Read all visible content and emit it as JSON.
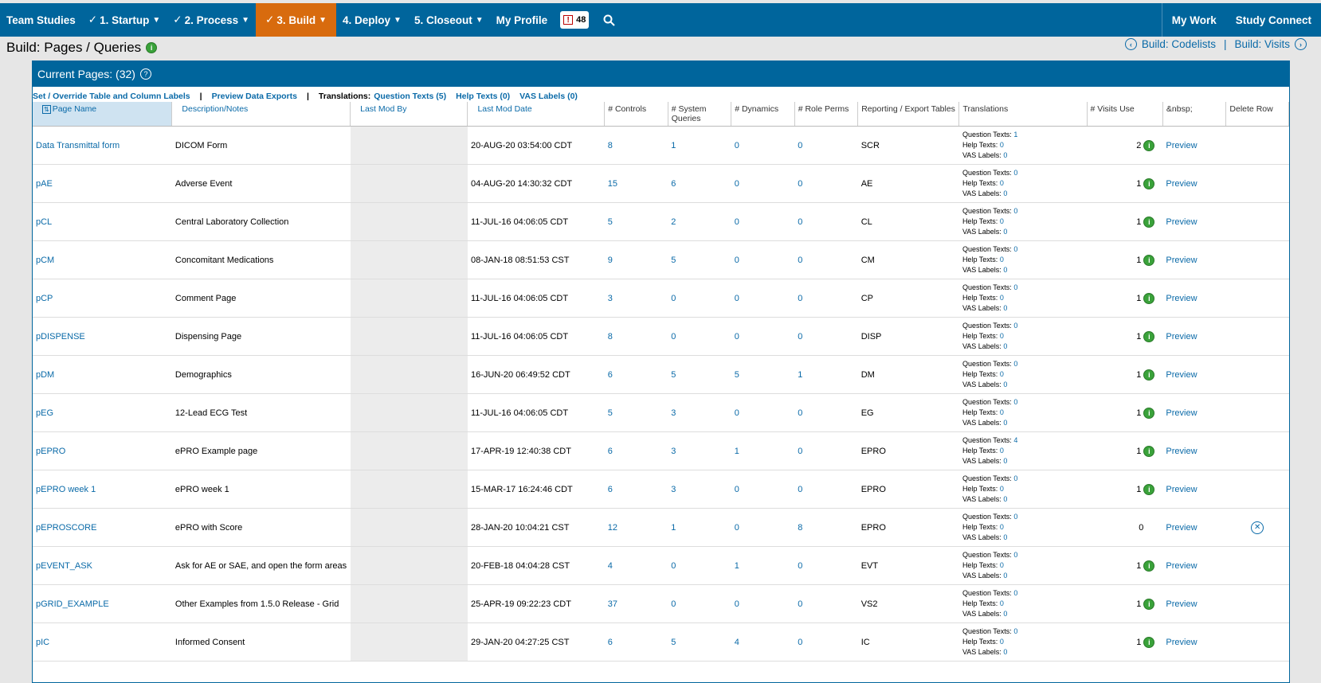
{
  "nav": {
    "brand": "Team Studies",
    "items": [
      {
        "label": "1. Startup",
        "check": true,
        "caret": true,
        "active": false
      },
      {
        "label": "2. Process",
        "check": true,
        "caret": true,
        "active": false
      },
      {
        "label": "3. Build",
        "check": true,
        "caret": true,
        "active": true
      },
      {
        "label": "4. Deploy",
        "check": false,
        "caret": true,
        "active": false
      },
      {
        "label": "5. Closeout",
        "check": false,
        "caret": true,
        "active": false
      },
      {
        "label": "My Profile",
        "check": false,
        "caret": false,
        "active": false
      }
    ],
    "alert_count": "48",
    "right": [
      "My Work",
      "Study Connect"
    ]
  },
  "page": {
    "title": "Build: Pages / Queries",
    "prev_link": "Build: Codelists",
    "separator": "|",
    "next_link": "Build: Visits"
  },
  "panel": {
    "title": "Current Pages: (32)",
    "links": {
      "override": "Set / Override Table and Column Labels",
      "preview": "Preview Data Exports",
      "translations_label": "Translations:",
      "question_texts": "Question Texts (5)",
      "help_texts": "Help Texts (0)",
      "vas_labels": "VAS Labels (0)"
    }
  },
  "columns": [
    "Page Name",
    "Description/Notes",
    "Last Mod By",
    "Last Mod Date",
    "# Controls",
    "# System Queries",
    "# Dynamics",
    "# Role Perms",
    "Reporting / Export Tables",
    "Translations",
    "# Visits Use",
    "&nbsp;",
    "Delete Row"
  ],
  "trans_labels": {
    "q": "Question Texts:",
    "h": "Help Texts:",
    "v": "VAS Labels:"
  },
  "preview_label": "Preview",
  "rows": [
    {
      "name": "Data Transmittal form",
      "desc": "DICOM Form",
      "date": "20-AUG-20 03:54:00 CDT",
      "controls": "8",
      "sysq": "1",
      "dyn": "0",
      "role": "0",
      "table": "SCR",
      "q": "1",
      "h": "0",
      "v": "0",
      "visits": "2",
      "info": true,
      "del": false
    },
    {
      "name": "pAE",
      "desc": "Adverse Event",
      "date": "04-AUG-20 14:30:32 CDT",
      "controls": "15",
      "sysq": "6",
      "dyn": "0",
      "role": "0",
      "table": "AE",
      "q": "0",
      "h": "0",
      "v": "0",
      "visits": "1",
      "info": true,
      "del": false
    },
    {
      "name": "pCL",
      "desc": "Central Laboratory Collection",
      "date": "11-JUL-16 04:06:05 CDT",
      "controls": "5",
      "sysq": "2",
      "dyn": "0",
      "role": "0",
      "table": "CL",
      "q": "0",
      "h": "0",
      "v": "0",
      "visits": "1",
      "info": true,
      "del": false
    },
    {
      "name": "pCM",
      "desc": "Concomitant Medications",
      "date": "08-JAN-18 08:51:53 CST",
      "controls": "9",
      "sysq": "5",
      "dyn": "0",
      "role": "0",
      "table": "CM",
      "q": "0",
      "h": "0",
      "v": "0",
      "visits": "1",
      "info": true,
      "del": false
    },
    {
      "name": "pCP",
      "desc": "Comment Page",
      "date": "11-JUL-16 04:06:05 CDT",
      "controls": "3",
      "sysq": "0",
      "dyn": "0",
      "role": "0",
      "table": "CP",
      "q": "0",
      "h": "0",
      "v": "0",
      "visits": "1",
      "info": true,
      "del": false
    },
    {
      "name": "pDISPENSE",
      "desc": "Dispensing Page",
      "date": "11-JUL-16 04:06:05 CDT",
      "controls": "8",
      "sysq": "0",
      "dyn": "0",
      "role": "0",
      "table": "DISP",
      "q": "0",
      "h": "0",
      "v": "0",
      "visits": "1",
      "info": true,
      "del": false
    },
    {
      "name": "pDM",
      "desc": "Demographics",
      "date": "16-JUN-20 06:49:52 CDT",
      "controls": "6",
      "sysq": "5",
      "dyn": "5",
      "role": "1",
      "table": "DM",
      "q": "0",
      "h": "0",
      "v": "0",
      "visits": "1",
      "info": true,
      "del": false
    },
    {
      "name": "pEG",
      "desc": "12-Lead ECG Test",
      "date": "11-JUL-16 04:06:05 CDT",
      "controls": "5",
      "sysq": "3",
      "dyn": "0",
      "role": "0",
      "table": "EG",
      "q": "0",
      "h": "0",
      "v": "0",
      "visits": "1",
      "info": true,
      "del": false
    },
    {
      "name": "pEPRO",
      "desc": "ePRO Example page",
      "date": "17-APR-19 12:40:38 CDT",
      "controls": "6",
      "sysq": "3",
      "dyn": "1",
      "role": "0",
      "table": "EPRO",
      "q": "4",
      "h": "0",
      "v": "0",
      "visits": "1",
      "info": true,
      "del": false
    },
    {
      "name": "pEPRO week 1",
      "desc": "ePRO week 1",
      "date": "15-MAR-17 16:24:46 CDT",
      "controls": "6",
      "sysq": "3",
      "dyn": "0",
      "role": "0",
      "table": "EPRO",
      "q": "0",
      "h": "0",
      "v": "0",
      "visits": "1",
      "info": true,
      "del": false
    },
    {
      "name": "pEPROSCORE",
      "desc": "ePRO with Score",
      "date": "28-JAN-20 10:04:21 CST",
      "controls": "12",
      "sysq": "1",
      "dyn": "0",
      "role": "8",
      "table": "EPRO",
      "q": "0",
      "h": "0",
      "v": "0",
      "visits": "0",
      "info": false,
      "del": true
    },
    {
      "name": "pEVENT_ASK",
      "desc": "Ask for AE or SAE, and open the form areas",
      "date": "20-FEB-18 04:04:28 CST",
      "controls": "4",
      "sysq": "0",
      "dyn": "1",
      "role": "0",
      "table": "EVT",
      "q": "0",
      "h": "0",
      "v": "0",
      "visits": "1",
      "info": true,
      "del": false
    },
    {
      "name": "pGRID_EXAMPLE",
      "desc": "Other Examples from 1.5.0 Release - Grid",
      "date": "25-APR-19 09:22:23 CDT",
      "controls": "37",
      "sysq": "0",
      "dyn": "0",
      "role": "0",
      "table": "VS2",
      "q": "0",
      "h": "0",
      "v": "0",
      "visits": "1",
      "info": true,
      "del": false
    },
    {
      "name": "pIC",
      "desc": "Informed Consent",
      "date": "29-JAN-20 04:27:25 CST",
      "controls": "6",
      "sysq": "5",
      "dyn": "4",
      "role": "0",
      "table": "IC",
      "q": "0",
      "h": "0",
      "v": "0",
      "visits": "1",
      "info": true,
      "del": false
    }
  ]
}
